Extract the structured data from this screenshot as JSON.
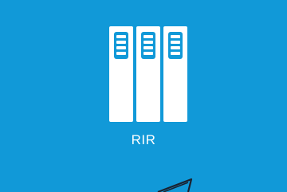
{
  "tile": {
    "label": "RIR",
    "icon": "server-racks-icon",
    "background_color": "#1199d8",
    "foreground_color": "#ffffff"
  }
}
